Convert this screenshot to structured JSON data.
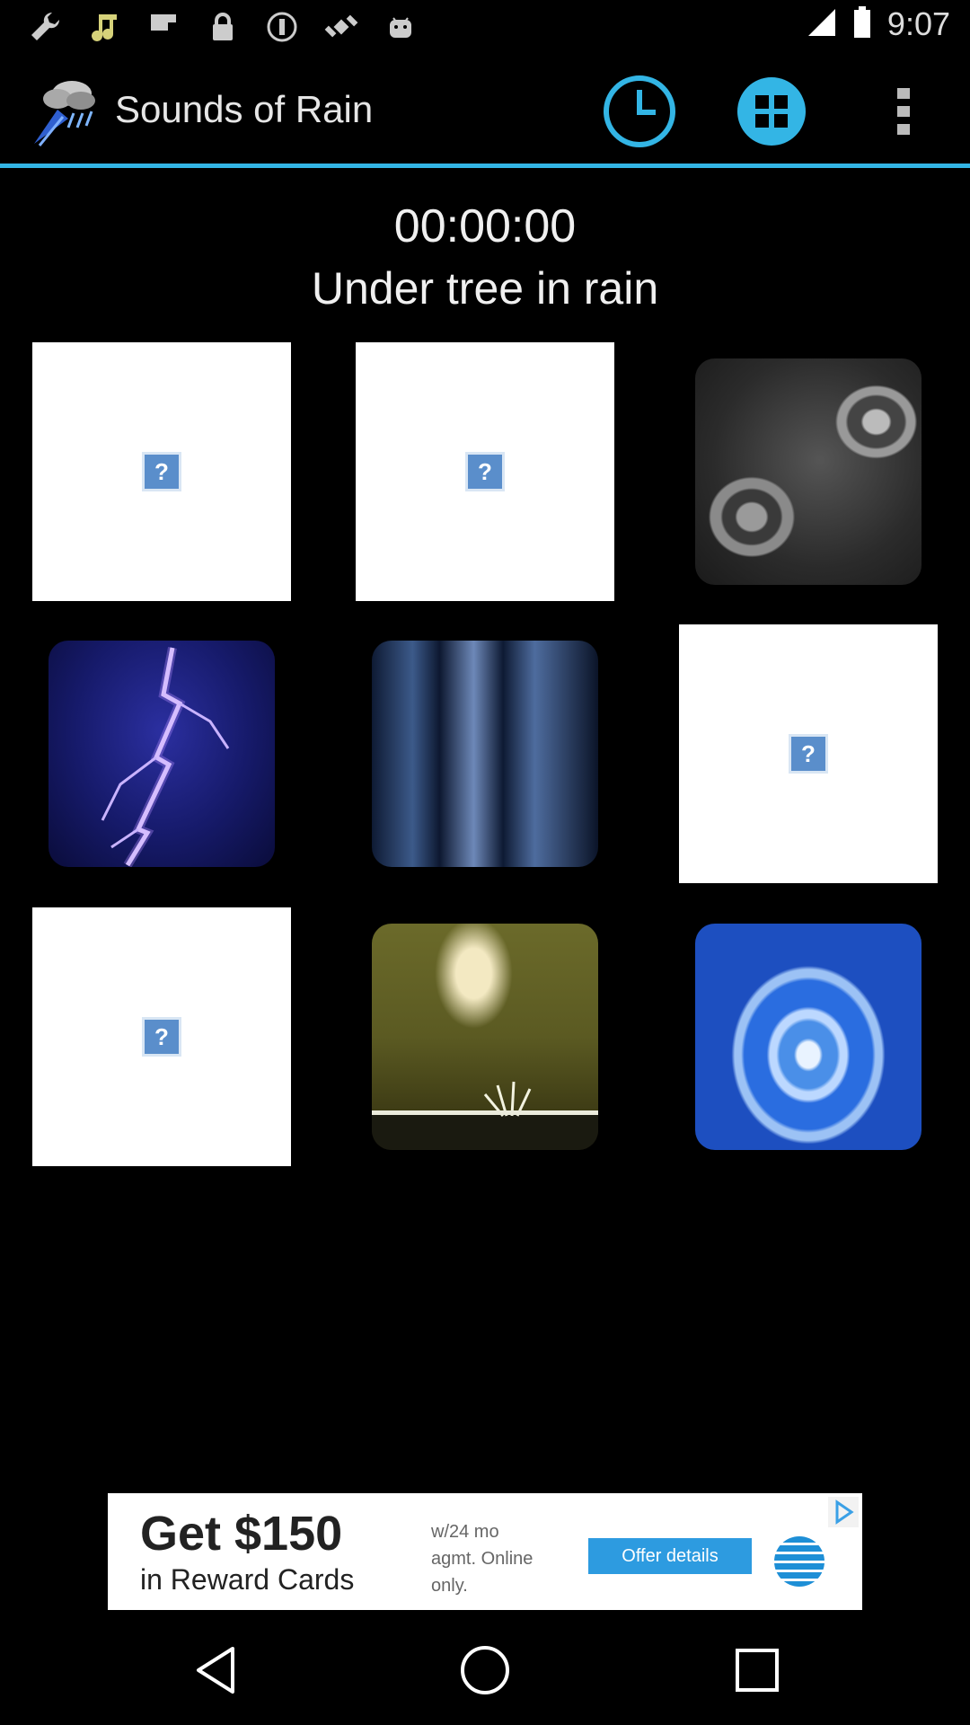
{
  "status_bar": {
    "time": "9:07",
    "left_icons": [
      "wrench-icon",
      "music-note-icon",
      "flipboard-icon",
      "lock-icon",
      "info-circle-icon",
      "satellite-icon",
      "android-icon"
    ],
    "right_icons": [
      "signal-icon",
      "battery-icon"
    ]
  },
  "action_bar": {
    "title": "Sounds of Rain",
    "logo": "rain-cloud-logo",
    "buttons": [
      "timer-icon",
      "grid-icon",
      "overflow-menu-icon"
    ],
    "accent_color": "#33b5e5"
  },
  "player": {
    "timer": "00:00:00",
    "sound_name": "Under tree in rain"
  },
  "sound_tiles": [
    {
      "kind": "broken-image",
      "icon": "broken-image-icon"
    },
    {
      "kind": "broken-image",
      "icon": "broken-image-icon"
    },
    {
      "kind": "image",
      "subject": "rain ripples on puddle"
    },
    {
      "kind": "image",
      "subject": "lightning"
    },
    {
      "kind": "image",
      "subject": "heavy rainfall"
    },
    {
      "kind": "broken-image",
      "icon": "broken-image-icon"
    },
    {
      "kind": "broken-image",
      "icon": "broken-image-icon"
    },
    {
      "kind": "image",
      "subject": "rain splash in grass"
    },
    {
      "kind": "image",
      "subject": "water drop"
    }
  ],
  "ad": {
    "headline": "Get $150",
    "subline": "in Reward Cards",
    "fine_print": "w/24 mo agmt. Online only.",
    "button": "Offer details",
    "logo": "att-globe-logo",
    "choices_icon": "ad-choices-icon"
  },
  "nav_bar": {
    "buttons": [
      "back-icon",
      "home-icon",
      "recents-icon"
    ]
  }
}
